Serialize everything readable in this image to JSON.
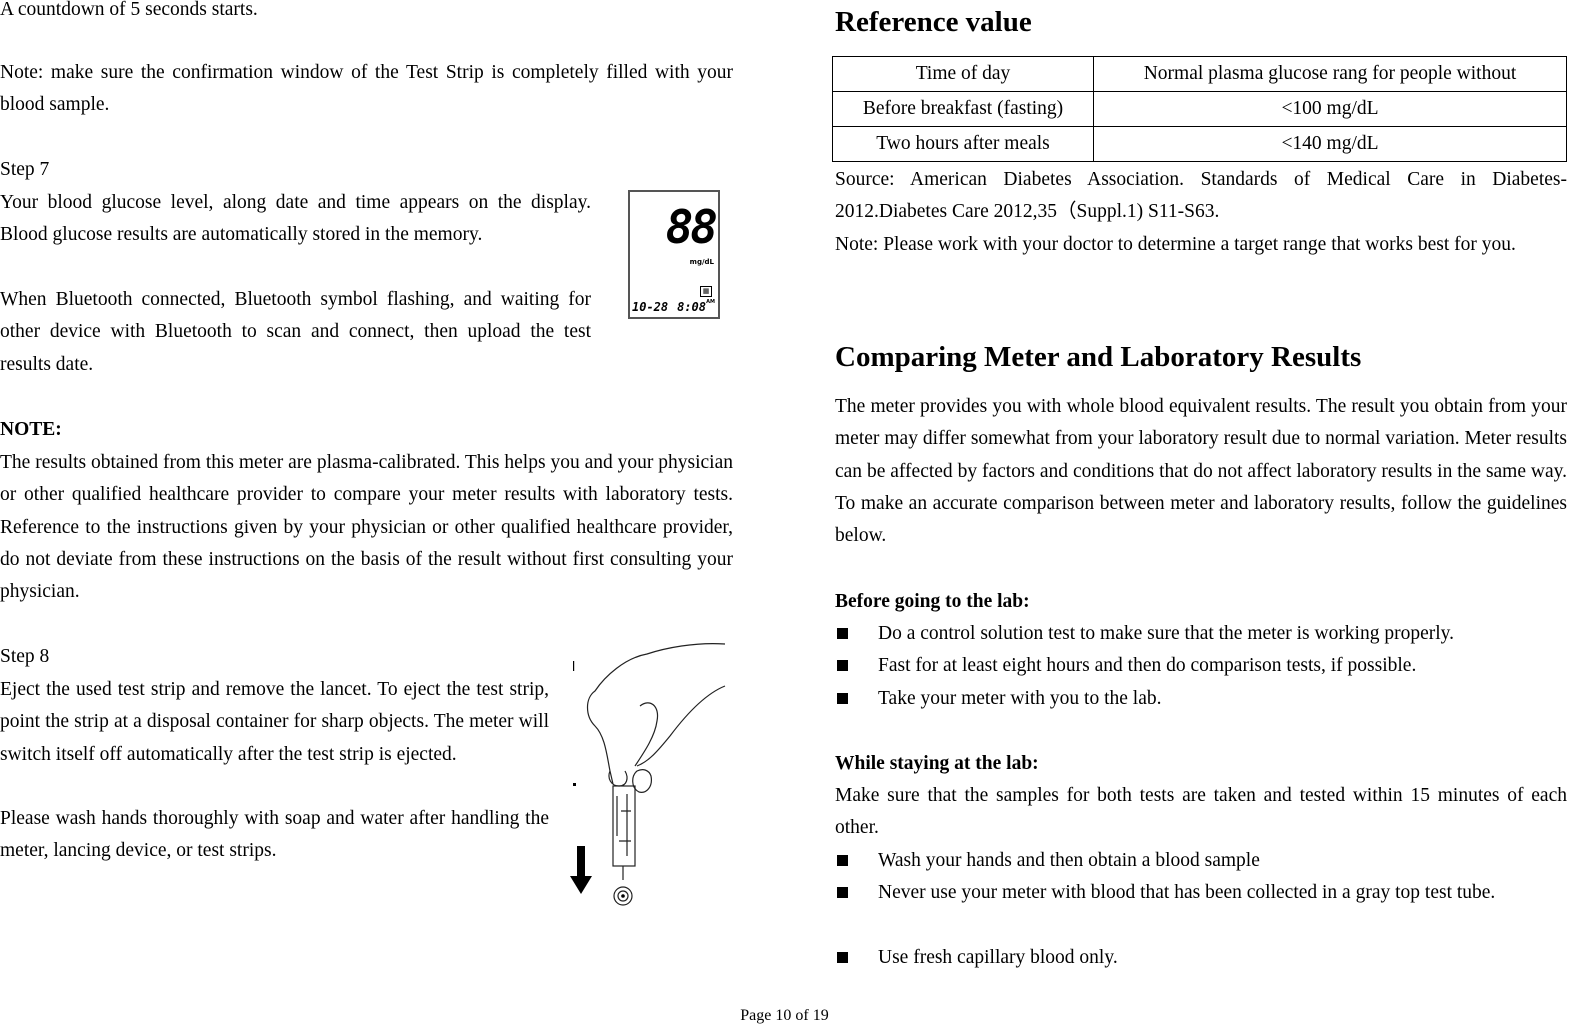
{
  "left": {
    "countdown": "A countdown of 5 seconds starts.",
    "note_fill": "Note: make sure the confirmation window of the Test Strip is completely filled with your blood sample.",
    "step7_title": "Step 7",
    "step7_p1": "Your blood glucose level, along date and time appears on the display. Blood glucose results are automatically stored in the memory.",
    "step7_p2": "When Bluetooth connected, Bluetooth symbol flashing, and waiting for other device with Bluetooth to scan and connect, then upload the test results date.",
    "meter_display": {
      "reading": "88",
      "unit": "mg/dL",
      "date": "10-28",
      "time": "8:08",
      "meridiem": "AM"
    },
    "note_title": "NOTE:",
    "note_body": "The results obtained from this meter are plasma-calibrated. This helps you and your physician or other qualified healthcare provider to compare your meter results with laboratory tests. Reference to the instructions given by your physician or other qualified healthcare provider, do not deviate from these instructions on the basis of the result without first consulting your physician.",
    "step8_title": "Step 8",
    "step8_p1": "Eject the used test strip and remove the lancet. To eject the test strip, point the strip at a disposal container for sharp objects. The meter will switch itself off automatically after the test strip is ejected.",
    "step8_p2": "Please wash hands thoroughly with soap and water after handling the meter, lancing device, or test strips."
  },
  "right": {
    "ref_title": "Reference value",
    "table": {
      "headers": [
        "Time of day",
        "Normal plasma glucose rang for people without"
      ],
      "rows": [
        [
          "Before breakfast (fasting)",
          "<100 mg/dL"
        ],
        [
          "Two hours after meals",
          "<140 mg/dL"
        ]
      ]
    },
    "source": "Source: American Diabetes Association. Standards of Medical Care in Diabetes-2012.Diabetes Care 2012,35（Suppl.1) S11-S63.",
    "note": "Note: Please work with your doctor to determine a target range that works best for you.",
    "compare_title": "Comparing Meter and Laboratory Results",
    "compare_body": "The meter provides you with whole blood equivalent results. The result you obtain from your meter may differ somewhat from your laboratory result due to normal variation. Meter results can be affected by factors and conditions that do not affect laboratory results in the same way. To make an accurate comparison between meter and laboratory results, follow the guidelines below.",
    "before_title": "Before going to the lab:",
    "before_items": [
      "Do a control solution test to make sure that the meter is working properly.",
      "Fast for at least eight hours and then do comparison tests, if possible.",
      "Take your meter with you to the lab."
    ],
    "while_title": "While staying at the lab:",
    "while_body": "Make sure that the samples for both tests are taken and tested within 15 minutes of each other.",
    "while_items": [
      "Wash your hands and then obtain a blood sample",
      "Never use your meter with blood that has been collected in a gray top test tube.",
      "Use fresh capillary blood only."
    ]
  },
  "footer": {
    "page": "Page 10 of 19"
  }
}
